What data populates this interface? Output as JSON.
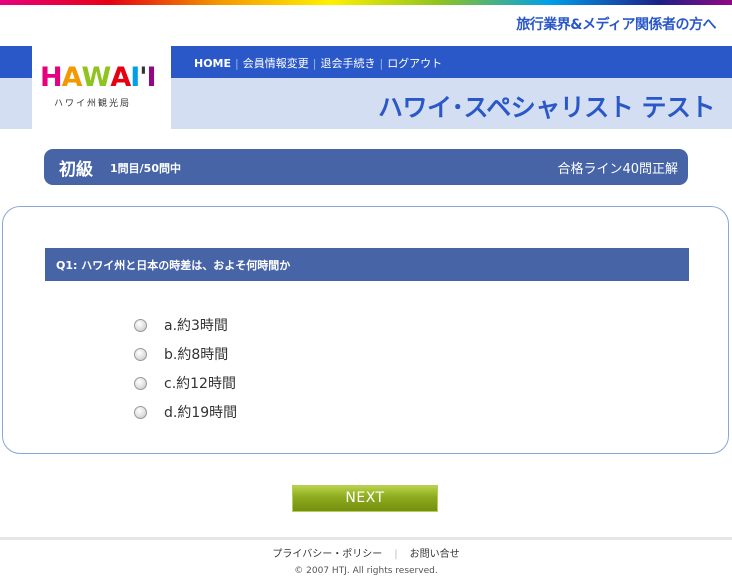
{
  "header": {
    "tagline": "旅行業界&メディア関係者の方へ",
    "logo": {
      "word_letters": [
        "H",
        "A",
        "W",
        "A",
        "I",
        "'",
        "I"
      ],
      "letter_colors": [
        "#e4007f",
        "#f39800",
        "#8fc31f",
        "#e60012",
        "#00a0e9",
        "#333333",
        "#920783"
      ],
      "subtitle": "ハワイ州観光局"
    },
    "nav": {
      "home": "HOME",
      "profile": "会員情報変更",
      "withdraw": "退会手続き",
      "logout": "ログアウト"
    },
    "title": "ハワイ･スペシャリスト テスト"
  },
  "quiz": {
    "level": "初級",
    "progress": "1問目/50問中",
    "pass_line": "合格ライン40問正解",
    "question": "Q1: ハワイ州と日本の時差は、およそ何時間か",
    "options": [
      "a.約3時間",
      "b.約8時間",
      "c.約12時間",
      "d.約19時間"
    ],
    "next_label": "NEXT"
  },
  "footer": {
    "privacy": "プライバシー・ポリシー",
    "contact": "お問い合せ",
    "copyright": "© 2007 HTJ. All rights reserved."
  },
  "colors": {
    "brand_blue": "#2a58c8",
    "panel_blue": "#4764a6",
    "pale_blue": "#d4def3",
    "next_green": "#8daa1e"
  }
}
